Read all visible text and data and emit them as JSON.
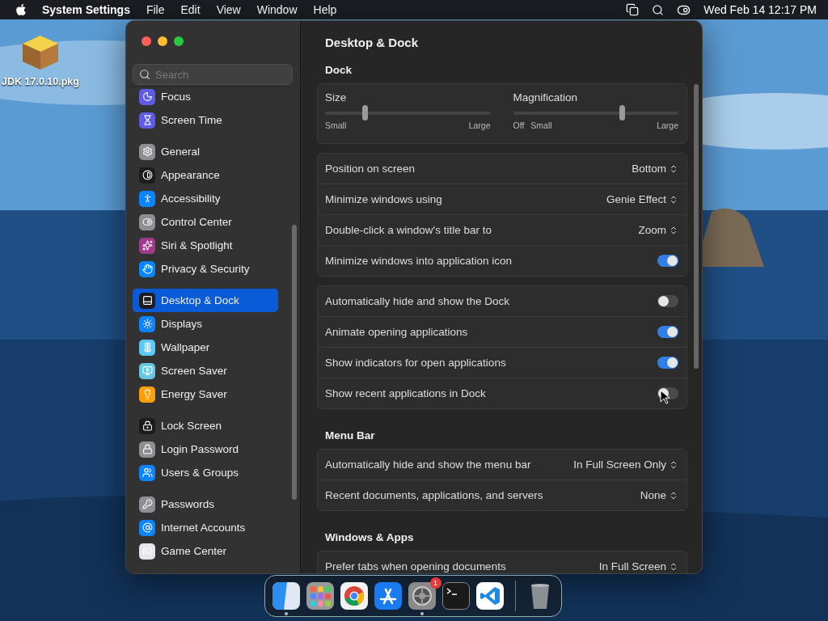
{
  "menu_bar": {
    "app_name": "System Settings",
    "menus": [
      "File",
      "Edit",
      "View",
      "Window",
      "Help"
    ],
    "clock": "Wed Feb 14  12:17 PM"
  },
  "desktop_icons": [
    {
      "label": "JDK 17.0.10.pkg"
    }
  ],
  "window": {
    "search": {
      "placeholder": "Search"
    },
    "sidebar": {
      "groups": [
        [
          {
            "label": "Focus",
            "color": "#5e5ce6",
            "selected": false
          },
          {
            "label": "Screen Time",
            "color": "#5e5ce6",
            "selected": false
          }
        ],
        [
          {
            "label": "General",
            "color": "#8e8e93",
            "selected": false
          },
          {
            "label": "Appearance",
            "color": "#1c1c1e",
            "selected": false
          },
          {
            "label": "Accessibility",
            "color": "#0a84ff",
            "selected": false
          },
          {
            "label": "Control Center",
            "color": "#8e8e93",
            "selected": false
          },
          {
            "label": "Siri & Spotlight",
            "color": "#a03a8c",
            "selected": false
          },
          {
            "label": "Privacy & Security",
            "color": "#0a84ff",
            "selected": false
          }
        ],
        [
          {
            "label": "Desktop & Dock",
            "color": "#1c1c1e",
            "selected": true
          },
          {
            "label": "Displays",
            "color": "#0a84ff",
            "selected": false
          },
          {
            "label": "Wallpaper",
            "color": "#5ac8fa",
            "selected": false
          },
          {
            "label": "Screen Saver",
            "color": "#64c8e0",
            "selected": false
          },
          {
            "label": "Energy Saver",
            "color": "#ff9f0a",
            "selected": false
          }
        ],
        [
          {
            "label": "Lock Screen",
            "color": "#1c1c1e",
            "selected": false
          },
          {
            "label": "Login Password",
            "color": "#8e8e93",
            "selected": false
          },
          {
            "label": "Users & Groups",
            "color": "#0a84ff",
            "selected": false
          }
        ],
        [
          {
            "label": "Passwords",
            "color": "#8e8e93",
            "selected": false
          },
          {
            "label": "Internet Accounts",
            "color": "#0a84ff",
            "selected": false
          },
          {
            "label": "Game Center",
            "color": "#e5e5ea",
            "selected": false
          }
        ]
      ]
    },
    "title": "Desktop & Dock",
    "sections": [
      {
        "title": "Dock",
        "cards": [
          {
            "kind": "sliders",
            "sliders": [
              {
                "label": "Size",
                "level": 0.24,
                "ticks": [
                  "Small",
                  "Large"
                ]
              },
              {
                "label": "Magnification",
                "level": 0.66,
                "ticks": [
                  "Off",
                  "Small",
                  "Large"
                ]
              }
            ]
          },
          {
            "kind": "rows",
            "rows": [
              {
                "kind": "popup",
                "label": "Position on screen",
                "value": "Bottom"
              },
              {
                "kind": "popup",
                "label": "Minimize windows using",
                "value": "Genie Effect"
              },
              {
                "kind": "popup",
                "label": "Double-click a window's title bar to",
                "value": "Zoom"
              },
              {
                "kind": "toggle",
                "label": "Minimize windows into application icon",
                "on": true
              }
            ]
          },
          {
            "kind": "rows",
            "rows": [
              {
                "kind": "toggle",
                "label": "Automatically hide and show the Dock",
                "on": false
              },
              {
                "kind": "toggle",
                "label": "Animate opening applications",
                "on": true
              },
              {
                "kind": "toggle",
                "label": "Show indicators for open applications",
                "on": true
              },
              {
                "kind": "toggle",
                "label": "Show recent applications in Dock",
                "on": false
              }
            ]
          }
        ]
      },
      {
        "title": "Menu Bar",
        "cards": [
          {
            "kind": "rows",
            "rows": [
              {
                "kind": "popup",
                "label": "Automatically hide and show the menu bar",
                "value": "In Full Screen Only"
              },
              {
                "kind": "popup",
                "label": "Recent documents, applications, and servers",
                "value": "None"
              }
            ]
          }
        ]
      },
      {
        "title": "Windows & Apps",
        "cards": [
          {
            "kind": "rows",
            "rows": [
              {
                "kind": "popup",
                "label": "Prefer tabs when opening documents",
                "value": "In Full Screen"
              }
            ]
          }
        ]
      }
    ]
  },
  "dock": {
    "apps": [
      {
        "kind": "finder",
        "running": true
      },
      {
        "kind": "launchpad",
        "running": false
      },
      {
        "kind": "browser",
        "running": false
      },
      {
        "kind": "appstore",
        "running": false
      },
      {
        "kind": "settings",
        "running": true,
        "badge": "1"
      },
      {
        "kind": "terminal",
        "running": false
      },
      {
        "kind": "editor",
        "running": false
      },
      {
        "kind": "trash",
        "running": false
      }
    ]
  }
}
